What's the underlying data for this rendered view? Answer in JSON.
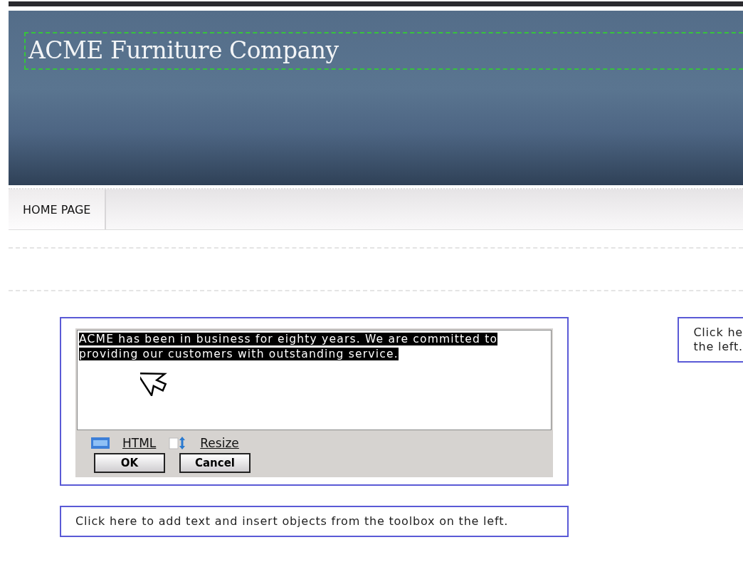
{
  "header": {
    "title": "ACME Furniture Company",
    "title_outlined": true
  },
  "nav": {
    "tabs": [
      {
        "label": "HOME PAGE",
        "selected": true
      }
    ]
  },
  "editor": {
    "text": "ACME has been in business for eighty years. We are committed to providing our customers with outstanding service.",
    "text_selected": true,
    "tools": [
      {
        "kind": "html",
        "label": "HTML"
      },
      {
        "kind": "resize",
        "label": "Resize"
      }
    ],
    "buttons": [
      "OK",
      "Cancel"
    ]
  },
  "placeholder_boxes": [
    {
      "lines": [
        "Click here to add text and insert objects from the toolbox on the left."
      ]
    }
  ],
  "side_box": {
    "lines": [
      "Click he",
      "the left."
    ]
  }
}
